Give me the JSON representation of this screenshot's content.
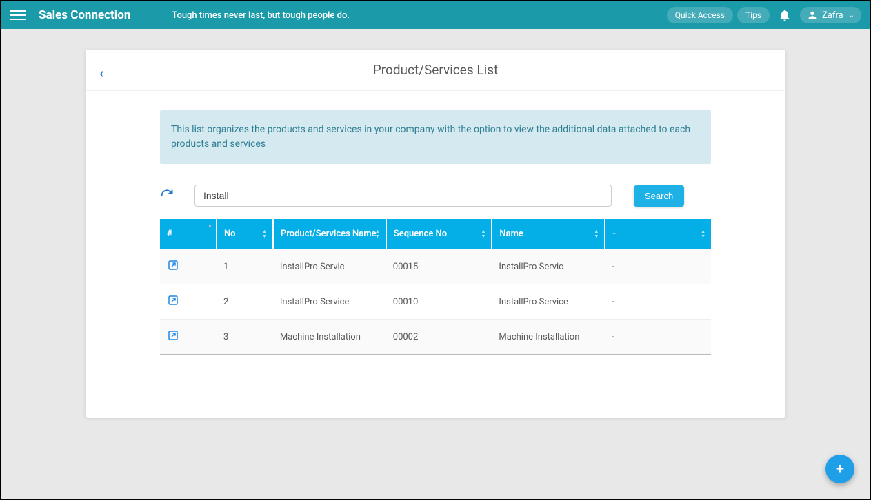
{
  "header": {
    "brand": "Sales Connection",
    "tagline": "Tough times never last, but tough people do.",
    "quick_access": "Quick Access",
    "tips": "Tips",
    "user_name": "Zafra"
  },
  "page": {
    "title": "Product/Services List",
    "banner": "This list organizes the products and services in your company with the option to view the additional data attached to each products and services"
  },
  "search": {
    "value": "Install",
    "button": "Search"
  },
  "columns": {
    "hash": "#",
    "no": "No",
    "psn": "Product/Services Name",
    "seq": "Sequence No",
    "name": "Name",
    "dash": "-"
  },
  "rows": [
    {
      "no": "1",
      "psn": "InstallPro Servic",
      "seq": "00015",
      "name": "InstallPro Servic",
      "dash": "-"
    },
    {
      "no": "2",
      "psn": "InstallPro Service",
      "seq": "00010",
      "name": "InstallPro Service",
      "dash": "-"
    },
    {
      "no": "3",
      "psn": "Machine Installation",
      "seq": "00002",
      "name": "Machine Installation",
      "dash": "-"
    }
  ],
  "fab": "+"
}
